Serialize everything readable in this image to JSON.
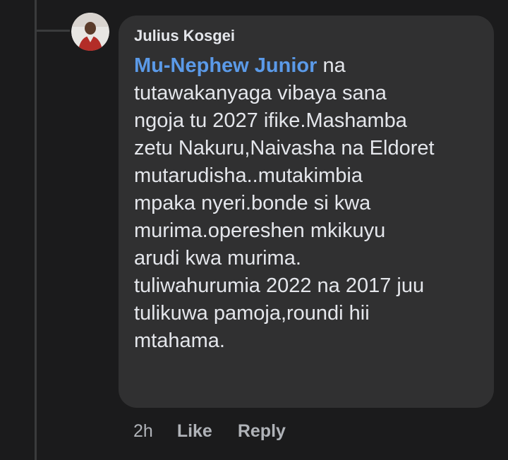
{
  "comment": {
    "author": "Julius Kosgei",
    "avatar_icon": "profile-photo-avatar",
    "mention": "Mu-Nephew Junior",
    "body": " na\ntutawakanyaga vibaya sana\nngoja tu 2027 ifike.Mashamba\nzetu Nakuru,Naivasha na Eldoret\nmutarudisha..mutakimbia\nmpaka nyeri.bonde si kwa\nmurima.opereshen mkikuyu\narudi kwa murima.\ntuliwahurumia 2022 na 2017 juu\ntulikuwa pamoja,roundi hii\nmtahama.",
    "timestamp": "2h",
    "like_label": "Like",
    "reply_label": "Reply"
  },
  "colors": {
    "background": "#1b1b1c",
    "bubble": "#303031",
    "text": "#e4e6eb",
    "mention": "#5b9ae8",
    "secondary": "#b0b3b8"
  }
}
